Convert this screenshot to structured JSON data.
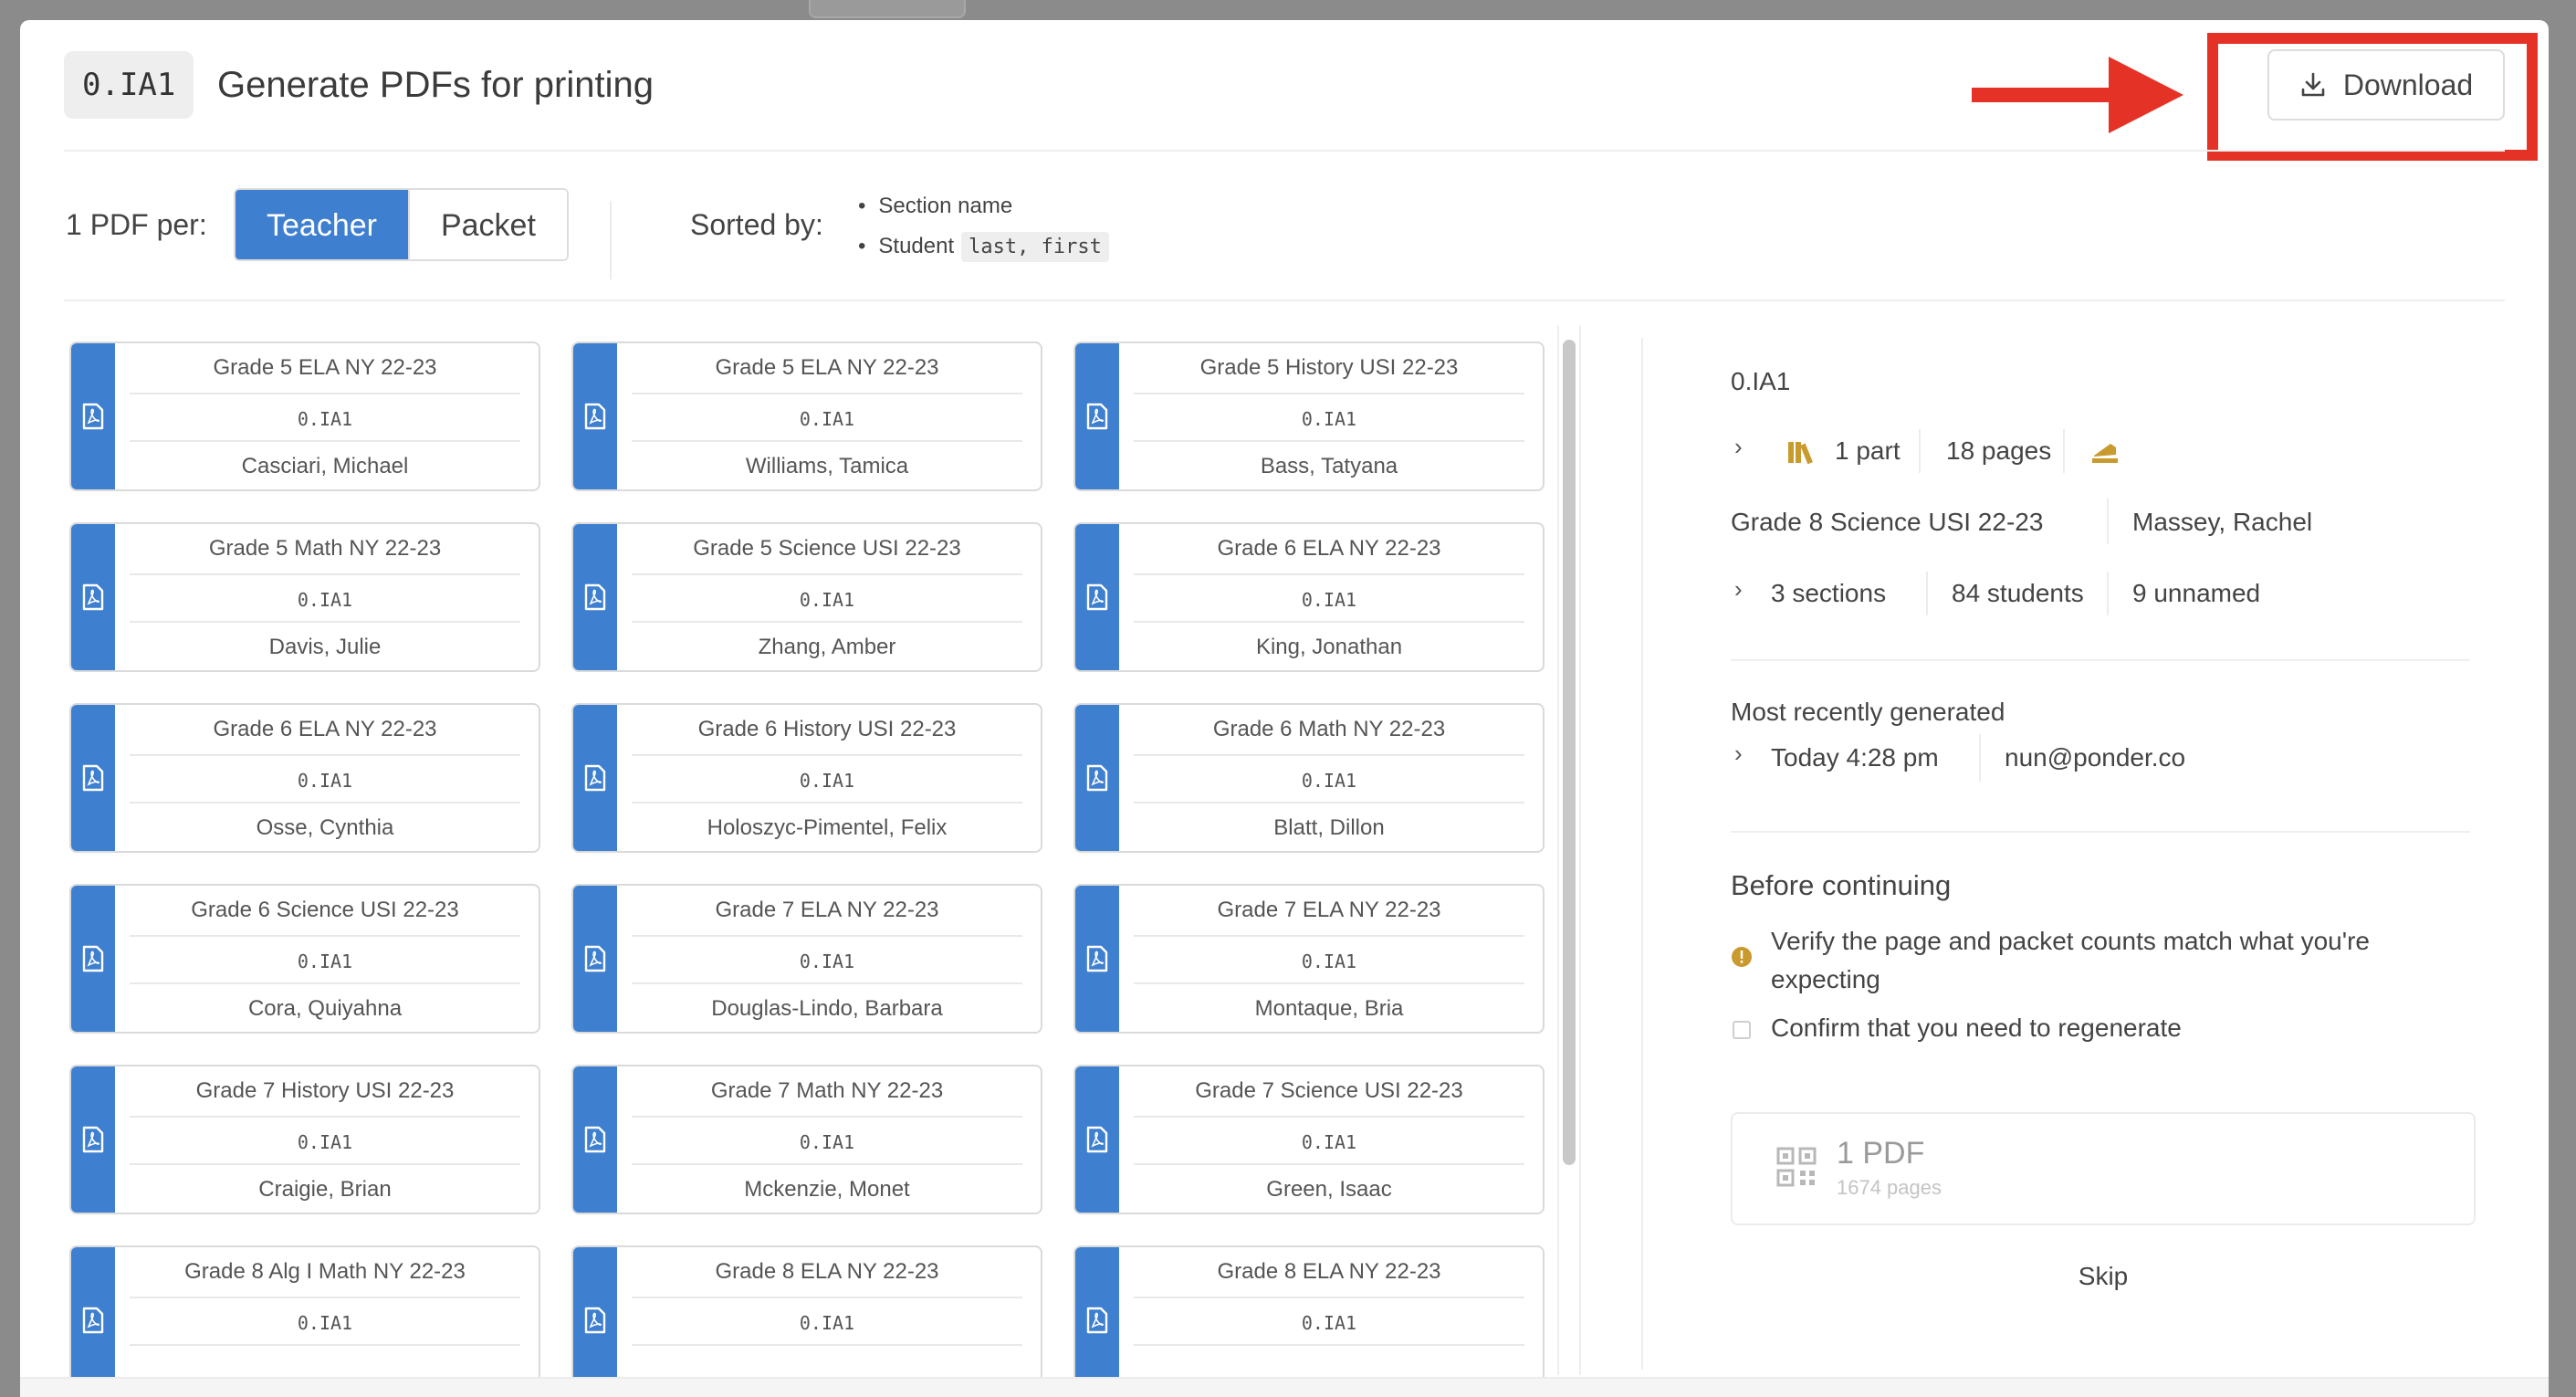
{
  "header": {
    "code": "0.IA1",
    "title": "Generate PDFs for printing",
    "download_label": "Download"
  },
  "controls": {
    "per_label": "1 PDF per:",
    "options": [
      "Teacher",
      "Packet"
    ],
    "selected": "Teacher",
    "sorted_label": "Sorted by:",
    "sort_items": [
      {
        "text": "Section name",
        "code": ""
      },
      {
        "text": "Student",
        "code": "last, first"
      }
    ]
  },
  "cards": [
    {
      "course": "Grade 5 ELA NY 22-23",
      "code": "0.IA1",
      "teacher": "Casciari, Michael"
    },
    {
      "course": "Grade 5 ELA NY 22-23",
      "code": "0.IA1",
      "teacher": "Williams, Tamica"
    },
    {
      "course": "Grade 5 History USI 22-23",
      "code": "0.IA1",
      "teacher": "Bass, Tatyana"
    },
    {
      "course": "Grade 5 Math NY 22-23",
      "code": "0.IA1",
      "teacher": "Davis, Julie"
    },
    {
      "course": "Grade 5 Science USI 22-23",
      "code": "0.IA1",
      "teacher": "Zhang, Amber"
    },
    {
      "course": "Grade 6 ELA NY 22-23",
      "code": "0.IA1",
      "teacher": "King, Jonathan"
    },
    {
      "course": "Grade 6 ELA NY 22-23",
      "code": "0.IA1",
      "teacher": "Osse, Cynthia"
    },
    {
      "course": "Grade 6 History USI 22-23",
      "code": "0.IA1",
      "teacher": "Holoszyc-Pimentel, Felix"
    },
    {
      "course": "Grade 6 Math NY 22-23",
      "code": "0.IA1",
      "teacher": "Blatt, Dillon"
    },
    {
      "course": "Grade 6 Science USI 22-23",
      "code": "0.IA1",
      "teacher": "Cora, Quiyahna"
    },
    {
      "course": "Grade 7 ELA NY 22-23",
      "code": "0.IA1",
      "teacher": "Douglas-Lindo, Barbara"
    },
    {
      "course": "Grade 7 ELA NY 22-23",
      "code": "0.IA1",
      "teacher": "Montaque, Bria"
    },
    {
      "course": "Grade 7 History USI 22-23",
      "code": "0.IA1",
      "teacher": "Craigie, Brian"
    },
    {
      "course": "Grade 7 Math NY 22-23",
      "code": "0.IA1",
      "teacher": "Mckenzie, Monet"
    },
    {
      "course": "Grade 7 Science USI 22-23",
      "code": "0.IA1",
      "teacher": "Green, Isaac"
    },
    {
      "course": "Grade 8 Alg I Math NY 22-23",
      "code": "0.IA1",
      "teacher": ""
    },
    {
      "course": "Grade 8 ELA NY 22-23",
      "code": "0.IA1",
      "teacher": ""
    },
    {
      "course": "Grade 8 ELA NY 22-23",
      "code": "0.IA1",
      "teacher": ""
    }
  ],
  "panel": {
    "code": "0.IA1",
    "parts": "1 part",
    "pages": "18 pages",
    "course": "Grade 8 Science USI 22-23",
    "teacher": "Massey, Rachel",
    "sections": "3 sections",
    "students": "84 students",
    "unnamed": "9 unnamed",
    "recent_label": "Most recently generated",
    "recent_time": "Today 4:28 pm",
    "recent_user": "nun@ponder.co",
    "before_label": "Before continuing",
    "verify_text": "Verify the page and packet counts match what you're expecting",
    "confirm_text": "Confirm that you need to regenerate",
    "pdf_count": "1 PDF",
    "pdf_pages": "1674 pages",
    "skip_label": "Skip"
  },
  "colors": {
    "accent_blue": "#3e7fd0",
    "annotation_red": "#e53226",
    "warning_gold": "#c99a2e"
  }
}
